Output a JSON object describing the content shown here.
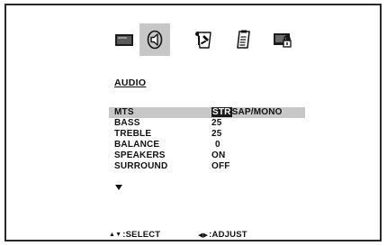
{
  "tabs": [
    {
      "id": "picture",
      "icon": "tv-screen-icon",
      "selected": false
    },
    {
      "id": "audio",
      "icon": "speaker-icon",
      "selected": true
    },
    {
      "id": "setup",
      "icon": "wrench-screwdriver-icon",
      "selected": false
    },
    {
      "id": "features",
      "icon": "notepad-icon",
      "selected": false
    },
    {
      "id": "lock",
      "icon": "padlock-screen-icon",
      "selected": false
    }
  ],
  "section_title": "AUDIO",
  "menu": {
    "items": [
      {
        "label": "MTS",
        "value_selected": "STR",
        "value_rest": "SAP/MONO",
        "highlighted": true
      },
      {
        "label": "BASS",
        "value": "25"
      },
      {
        "label": "TREBLE",
        "value": "25"
      },
      {
        "label": "BALANCE",
        "value": "0"
      },
      {
        "label": "SPEAKERS",
        "value": "ON"
      },
      {
        "label": "SURROUND",
        "value": "OFF"
      }
    ],
    "more_indicator": "down-arrow-icon"
  },
  "help": {
    "select_glyph": "▲▼",
    "select_text": ":SELECT",
    "adjust_glyph": "◀▶",
    "adjust_text": ":ADJUST"
  },
  "colors": {
    "highlight": "#c7c7c7",
    "selected_option_bg": "#1b1b1b",
    "text": "#111111"
  }
}
